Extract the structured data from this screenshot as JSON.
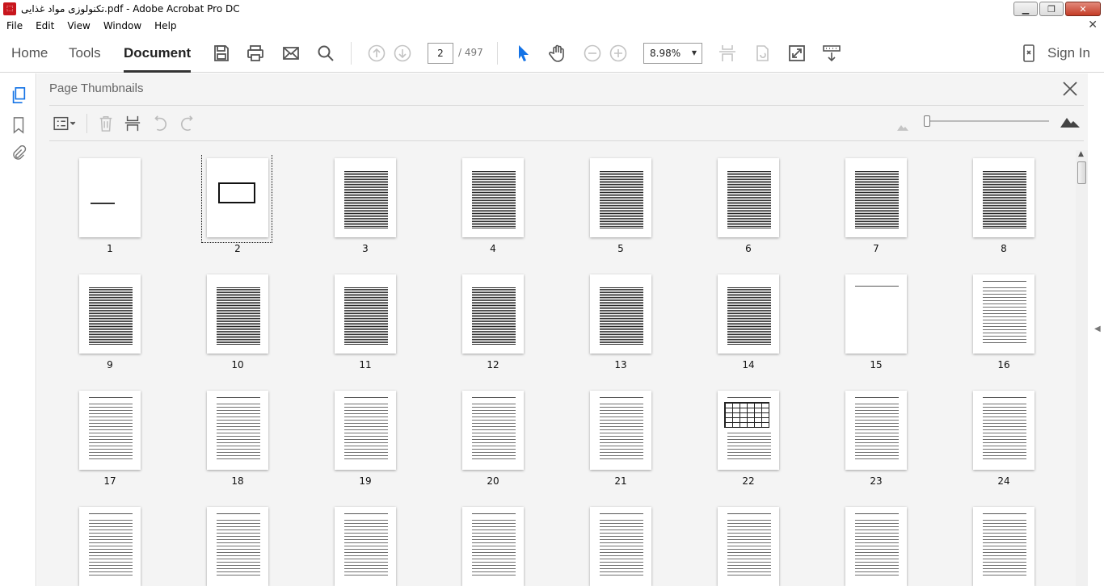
{
  "window": {
    "title": "تکنولوزی مواد غذایی.pdf - Adobe Acrobat Pro DC",
    "app_icon": "pdf-icon",
    "controls": {
      "minimize": "▁",
      "maximize": "❐",
      "close": "✕"
    }
  },
  "menu": [
    "File",
    "Edit",
    "View",
    "Window",
    "Help"
  ],
  "menu_close": "✕",
  "nav": {
    "home": "Home",
    "tools": "Tools",
    "document": "Document",
    "sign_in": "Sign In"
  },
  "toolbar": {
    "page_current": "2",
    "page_total": "/ 497",
    "zoom": "8.98%",
    "zoom_caret": "▼"
  },
  "panel": {
    "title": "Page Thumbnails",
    "close": "close-icon"
  },
  "thumbnails": [
    {
      "n": "1",
      "kind": "blank-title"
    },
    {
      "n": "2",
      "kind": "cover",
      "selected": true
    },
    {
      "n": "3",
      "kind": "dense"
    },
    {
      "n": "4",
      "kind": "dense"
    },
    {
      "n": "5",
      "kind": "dense"
    },
    {
      "n": "6",
      "kind": "dense"
    },
    {
      "n": "7",
      "kind": "dense"
    },
    {
      "n": "8",
      "kind": "dense"
    },
    {
      "n": "9",
      "kind": "dense"
    },
    {
      "n": "10",
      "kind": "dense"
    },
    {
      "n": "11",
      "kind": "dense"
    },
    {
      "n": "12",
      "kind": "dense"
    },
    {
      "n": "13",
      "kind": "dense"
    },
    {
      "n": "14",
      "kind": "dense"
    },
    {
      "n": "15",
      "kind": "blank"
    },
    {
      "n": "16",
      "kind": "text"
    },
    {
      "n": "17",
      "kind": "text"
    },
    {
      "n": "18",
      "kind": "text"
    },
    {
      "n": "19",
      "kind": "text"
    },
    {
      "n": "20",
      "kind": "text"
    },
    {
      "n": "21",
      "kind": "text"
    },
    {
      "n": "22",
      "kind": "table"
    },
    {
      "n": "23",
      "kind": "text"
    },
    {
      "n": "24",
      "kind": "text"
    },
    {
      "n": "",
      "kind": "text"
    },
    {
      "n": "",
      "kind": "text"
    },
    {
      "n": "",
      "kind": "text"
    },
    {
      "n": "",
      "kind": "text"
    },
    {
      "n": "",
      "kind": "text"
    },
    {
      "n": "",
      "kind": "text"
    },
    {
      "n": "",
      "kind": "text"
    },
    {
      "n": "",
      "kind": "text"
    }
  ],
  "colors": {
    "accent": "#1473e6",
    "panel_bg": "#f4f4f4",
    "pdf_red": "#c8161d"
  }
}
